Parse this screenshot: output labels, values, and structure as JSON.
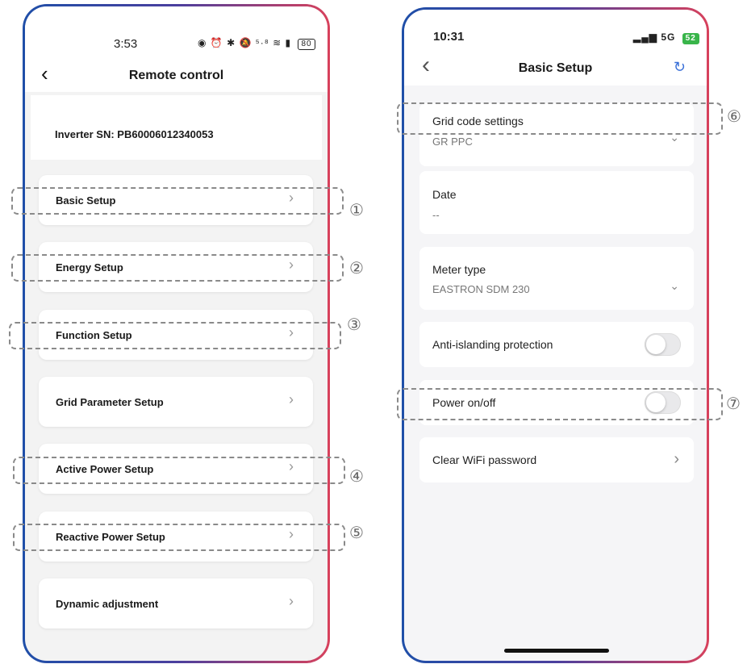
{
  "left": {
    "status": {
      "time": "3:53",
      "icons": "◉ ⏰ ✱ 🔕 ⁵·⁸ ≋ ▮",
      "battery": "80"
    },
    "title": "Remote control",
    "inverter_sn": "Inverter SN: PB60006012340053",
    "items": [
      {
        "label": "Basic Setup"
      },
      {
        "label": "Energy Setup"
      },
      {
        "label": "Function Setup"
      },
      {
        "label": "Grid Parameter Setup"
      },
      {
        "label": "Active Power Setup"
      },
      {
        "label": "Reactive Power Setup"
      },
      {
        "label": "Dynamic adjustment"
      }
    ],
    "chevron": "›",
    "back_glyph": "‹"
  },
  "right": {
    "status": {
      "time": "10:31",
      "signal": "▂▄▆",
      "network": "5G",
      "battery": "52"
    },
    "title": "Basic Setup",
    "back_glyph": "‹",
    "refresh_glyph": "↻",
    "grid_code": {
      "label": "Grid code settings",
      "value": "GR PPC"
    },
    "date": {
      "label": "Date",
      "value": "--"
    },
    "meter": {
      "label": "Meter type",
      "value": "EASTRON SDM 230"
    },
    "anti_islanding": {
      "label": "Anti-islanding protection",
      "on": false
    },
    "power": {
      "label": "Power on/off",
      "on": false
    },
    "clear_wifi": {
      "label": "Clear WiFi password"
    },
    "chevron": "›",
    "dropdown": "⌄"
  },
  "annotations": [
    "①",
    "②",
    "③",
    "④",
    "⑤",
    "⑥",
    "⑦"
  ]
}
